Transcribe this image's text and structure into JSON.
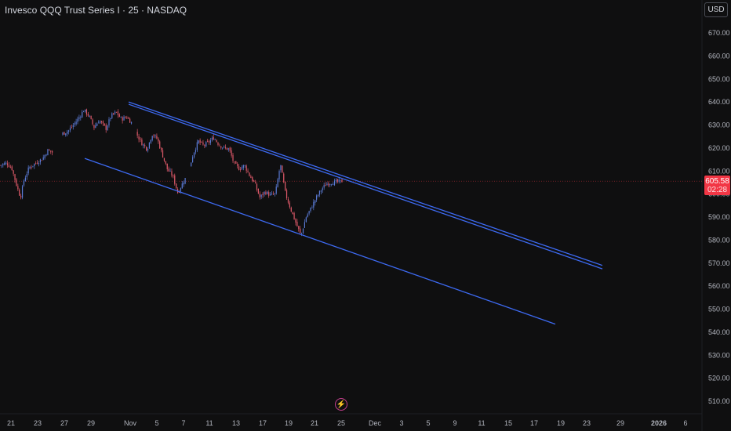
{
  "header": {
    "symbol_title": "Invesco QQQ Trust Series I · 25 · NASDAQ"
  },
  "toolbar": {
    "currency_label": "USD"
  },
  "price_badge": {
    "price": "605.58",
    "countdown": "02:28",
    "color": "#f23645"
  },
  "events": {
    "icon": "lightning-bolt-icon"
  },
  "colors": {
    "background": "#0f0f10",
    "up_candle": "#5b7bd6",
    "down_candle": "#e05a6a",
    "trendline": "#3d6af2",
    "axis_text": "#b2b5be"
  },
  "chart_data": {
    "type": "candlestick",
    "ylim": [
      505,
      676
    ],
    "yticks": [
      510,
      520,
      530,
      540,
      550,
      560,
      570,
      580,
      590,
      600,
      610,
      620,
      630,
      640,
      650,
      660,
      670
    ],
    "ytick_labels": [
      "510.00",
      "520.00",
      "530.00",
      "540.00",
      "550.00",
      "560.00",
      "570.00",
      "580.00",
      "590.00",
      "600.00",
      "610.00",
      "620.00",
      "630.00",
      "640.00",
      "650.00",
      "660.00",
      "670.00"
    ],
    "x_labels": [
      "21",
      "23",
      "27",
      "29",
      "Nov",
      "5",
      "7",
      "11",
      "13",
      "17",
      "19",
      "21",
      "25",
      "Dec",
      "3",
      "5",
      "9",
      "11",
      "15",
      "17",
      "19",
      "23",
      "29",
      "2026",
      "6"
    ],
    "last_price": 605.58,
    "close_path": [
      [
        0,
        612.5
      ],
      [
        0.02,
        613.5
      ],
      [
        0.035,
        611.0
      ],
      [
        0.05,
        603.0
      ],
      [
        0.06,
        598.5
      ],
      [
        0.07,
        606.0
      ],
      [
        0.085,
        611.5
      ],
      [
        0.1,
        613.0
      ],
      [
        0.125,
        615.5
      ],
      [
        0.14,
        619.0
      ],
      [
        0.155,
        618.0
      ],
      [
        0.18,
        626.0
      ],
      [
        0.2,
        627.5
      ],
      [
        0.215,
        630.0
      ],
      [
        0.23,
        633.0
      ],
      [
        0.245,
        636.5
      ],
      [
        0.26,
        634.0
      ],
      [
        0.275,
        629.0
      ],
      [
        0.29,
        632.0
      ],
      [
        0.31,
        628.5
      ],
      [
        0.325,
        634.0
      ],
      [
        0.34,
        635.5
      ],
      [
        0.355,
        632.5
      ],
      [
        0.37,
        633.5
      ],
      [
        0.385,
        631.0
      ],
      [
        0.4,
        626.0
      ],
      [
        0.415,
        622.0
      ],
      [
        0.43,
        619.5
      ],
      [
        0.445,
        626.0
      ],
      [
        0.46,
        624.0
      ],
      [
        0.475,
        617.0
      ],
      [
        0.49,
        610.5
      ],
      [
        0.505,
        608.0
      ],
      [
        0.52,
        600.5
      ],
      [
        0.535,
        605.0
      ],
      [
        0.55,
        609.0
      ],
      [
        0.565,
        617.5
      ],
      [
        0.58,
        623.0
      ],
      [
        0.595,
        621.0
      ],
      [
        0.61,
        622.5
      ],
      [
        0.625,
        624.5
      ],
      [
        0.64,
        621.5
      ],
      [
        0.655,
        620.0
      ],
      [
        0.67,
        619.5
      ],
      [
        0.685,
        613.0
      ],
      [
        0.7,
        611.0
      ],
      [
        0.715,
        612.5
      ],
      [
        0.73,
        608.0
      ],
      [
        0.745,
        604.5
      ],
      [
        0.76,
        598.5
      ],
      [
        0.775,
        601.0
      ],
      [
        0.79,
        599.5
      ],
      [
        0.805,
        600.0
      ],
      [
        0.82,
        613.0
      ],
      [
        0.835,
        600.0
      ],
      [
        0.85,
        593.5
      ],
      [
        0.865,
        587.5
      ],
      [
        0.88,
        582.0
      ],
      [
        0.895,
        590.0
      ],
      [
        0.91,
        594.0
      ],
      [
        0.925,
        598.5
      ],
      [
        0.94,
        602.0
      ],
      [
        0.955,
        604.5
      ],
      [
        0.97,
        605.0
      ],
      [
        1.0,
        605.58
      ]
    ],
    "trendlines": [
      {
        "x_start": "Nov",
        "y_start": 640.0,
        "x_end": "Dec 26",
        "y_end": 569.0
      },
      {
        "x_start": "Nov",
        "y_start": 639.0,
        "x_end": "Dec 26",
        "y_end": 567.5
      },
      {
        "x_start": "Oct 28",
        "y_start": 615.5,
        "x_end": "Dec 19",
        "y_end": 543.5
      }
    ]
  }
}
